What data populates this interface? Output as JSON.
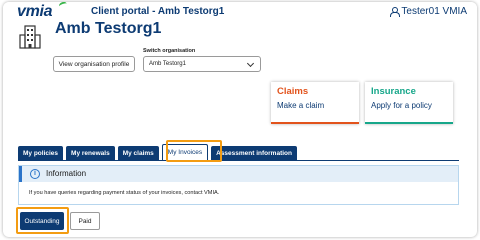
{
  "header": {
    "logo_text": "vmia",
    "portal_title": "Client portal - Amb Testorg1",
    "user_name": "Tester01 VMIA"
  },
  "organisation": {
    "name": "Amb Testorg1",
    "view_profile_label": "View organisation profile",
    "switch_label": "Switch organisation",
    "switch_value": "Amb Testorg1"
  },
  "cards": [
    {
      "title": "Claims",
      "subtitle": "Make a claim",
      "accent": "#e2531c"
    },
    {
      "title": "Insurance",
      "subtitle": "Apply for a policy",
      "accent": "#17a78a"
    }
  ],
  "tabs": [
    {
      "label": "My policies",
      "active": false
    },
    {
      "label": "My renewals",
      "active": false
    },
    {
      "label": "My claims",
      "active": false
    },
    {
      "label": "My Invoices",
      "active": true
    },
    {
      "label": "Assessment information",
      "active": false
    }
  ],
  "info": {
    "title": "Information",
    "text": "If you have queries regarding payment status of your invoices, contact VMIA."
  },
  "filters": {
    "outstanding_label": "Outstanding",
    "paid_label": "Paid"
  },
  "colors": {
    "brand_navy": "#0d3b73",
    "highlight": "#f39c12"
  },
  "icons": {
    "user": "user-icon",
    "building": "building-icon",
    "info": "info-icon",
    "dropdown": "chevron-down-icon"
  }
}
